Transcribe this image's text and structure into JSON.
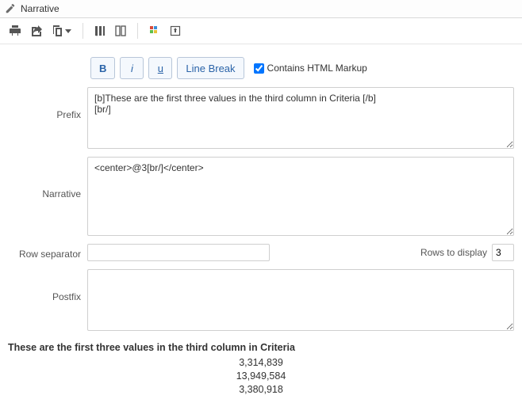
{
  "header": {
    "title": "Narrative"
  },
  "format_buttons": {
    "bold": "B",
    "italic": "i",
    "underline": "u",
    "line_break": "Line Break"
  },
  "contains_markup": {
    "label": "Contains HTML Markup",
    "checked": true
  },
  "fields": {
    "prefix": {
      "label": "Prefix",
      "value": "[b]These are the first three values in the third column in Criteria [/b]\n[br/]"
    },
    "narrative": {
      "label": "Narrative",
      "value": "<center>@3[br/]</center>"
    },
    "row_separator": {
      "label": "Row separator",
      "value": ""
    },
    "rows_to_display": {
      "label": "Rows to display",
      "value": "3"
    },
    "postfix": {
      "label": "Postfix",
      "value": ""
    }
  },
  "preview": {
    "title": "These are the first three values in the third column in Criteria",
    "values": [
      "3,314,839",
      "13,949,584",
      "3,380,918"
    ]
  }
}
